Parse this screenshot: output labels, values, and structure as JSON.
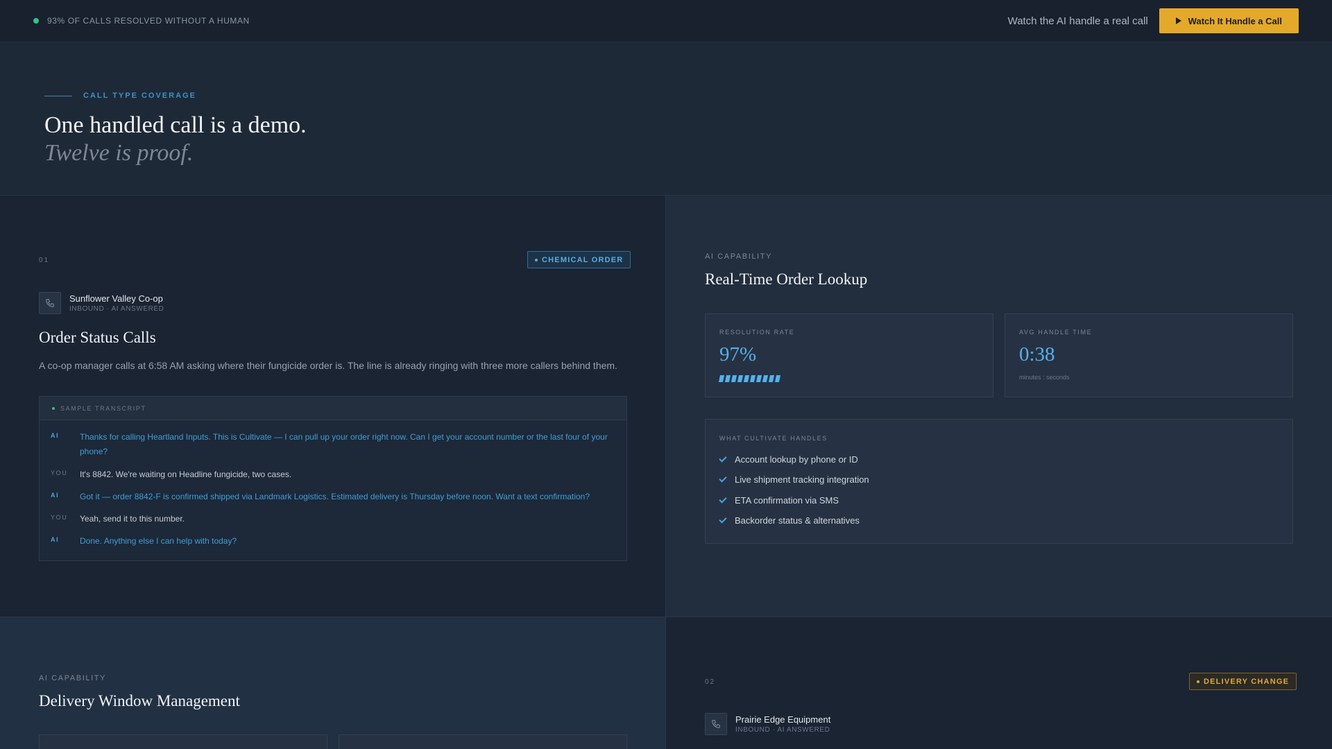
{
  "topbar": {
    "status_text": "93% OF CALLS RESOLVED WITHOUT A HUMAN",
    "watch_text": "Watch the AI handle a real call",
    "cta_label": "Watch It Handle a Call"
  },
  "hero": {
    "eyebrow": "CALL TYPE COVERAGE",
    "title": "One handled call is a demo.",
    "subtitle": "Twelve is proof."
  },
  "call1": {
    "number": "01",
    "tag": "CHEMICAL ORDER",
    "caller_name": "Sunflower Valley Co-op",
    "caller_meta": "INBOUND · AI ANSWERED",
    "title": "Order Status Calls",
    "description": "A co-op manager calls at 6:58 AM asking where their fungicide order is. The line is already ringing with three more callers behind them.",
    "transcript_title": "SAMPLE TRANSCRIPT",
    "transcript": [
      {
        "who": "AI",
        "text": "Thanks for calling Heartland Inputs. This is Cultivate — I can pull up your order right now. Can I get your account number or the last four of your phone?"
      },
      {
        "who": "YOU",
        "text": "It's 8842. We're waiting on Headline fungicide, two cases."
      },
      {
        "who": "AI",
        "text": "Got it — order 8842-F is confirmed shipped via Landmark Logistics. Estimated delivery is Thursday before noon. Want a text confirmation?"
      },
      {
        "who": "YOU",
        "text": "Yeah, send it to this number."
      },
      {
        "who": "AI",
        "text": "Done. Anything else I can help with today?"
      }
    ]
  },
  "capability1": {
    "kicker": "AI CAPABILITY",
    "title": "Real-Time Order Lookup",
    "resolution_label": "RESOLUTION RATE",
    "resolution_value": "97%",
    "resolution_fraction": 0.97,
    "handle_label": "AVG HANDLE TIME",
    "handle_value": "0:38",
    "handle_sub": "minutes : seconds",
    "handles_title": "WHAT CULTIVATE HANDLES",
    "handles": [
      "Account lookup by phone or ID",
      "Live shipment tracking integration",
      "ETA confirmation via SMS",
      "Backorder status & alternatives"
    ]
  },
  "capability2": {
    "kicker": "AI CAPABILITY",
    "title": "Delivery Window Management"
  },
  "call2": {
    "number": "02",
    "tag": "DELIVERY CHANGE",
    "caller_name": "Prairie Edge Equipment",
    "caller_meta": "INBOUND · AI ANSWERED"
  },
  "colors": {
    "accent_gold": "#e4a92b",
    "accent_blue": "#55b0ea",
    "status_green": "#2fc48a"
  }
}
